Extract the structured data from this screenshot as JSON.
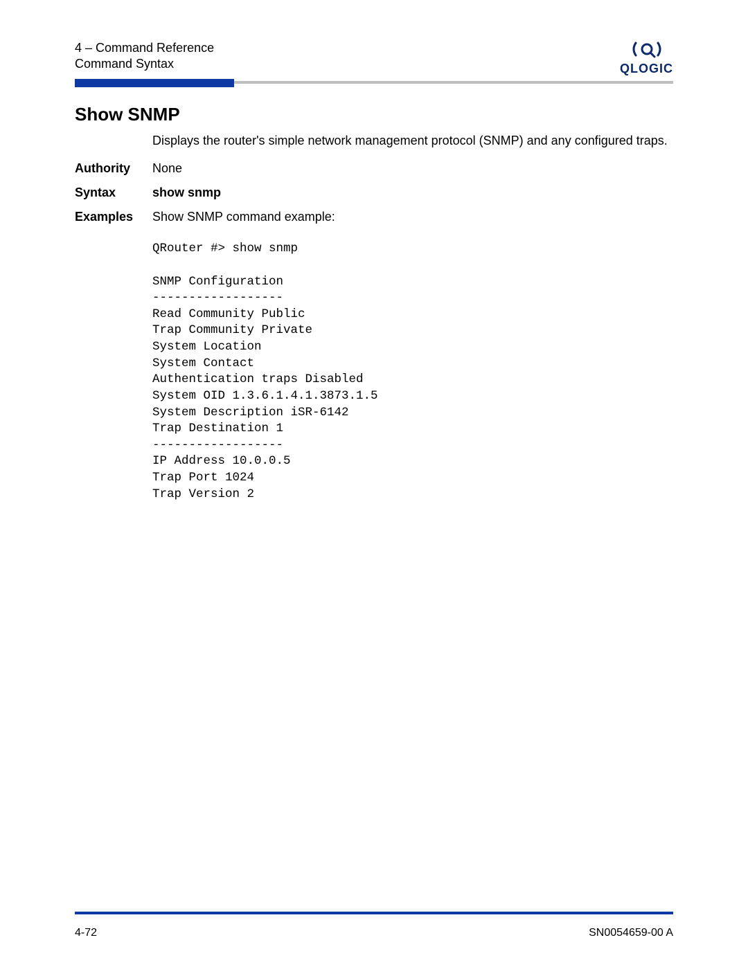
{
  "header": {
    "line1": "4 – Command Reference",
    "line2": "Command Syntax",
    "logo_text": "QLOGIC"
  },
  "title": "Show SNMP",
  "intro": "Displays the router's simple network management protocol (SNMP) and any configured traps.",
  "fields": {
    "authority_label": "Authority",
    "authority_value": "None",
    "syntax_label": "Syntax",
    "syntax_value": "show snmp",
    "examples_label": "Examples",
    "examples_intro": "Show SNMP command example:"
  },
  "example_output": "QRouter #> show snmp\n\nSNMP Configuration\n------------------\nRead Community Public\nTrap Community Private\nSystem Location\nSystem Contact\nAuthentication traps Disabled\nSystem OID 1.3.6.1.4.1.3873.1.5\nSystem Description iSR-6142\nTrap Destination 1\n------------------\nIP Address 10.0.0.5\nTrap Port 1024\nTrap Version 2",
  "footer": {
    "left": "4-72",
    "right": "SN0054659-00 A"
  }
}
